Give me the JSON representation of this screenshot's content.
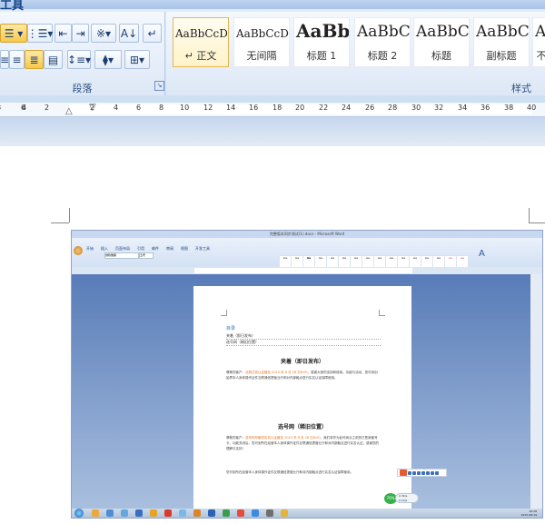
{
  "ribbon": {
    "tab_label": "工具",
    "paragraph_group_label": "段落",
    "styles_group_label": "样式",
    "styles": [
      {
        "sample": "AaBbCcDd",
        "name": "↵ 正文"
      },
      {
        "sample": "AaBbCcDc",
        "name": "无间隔"
      },
      {
        "sample": "AaBb",
        "name": "标题 1"
      },
      {
        "sample": "AaBbC",
        "name": "标题 2"
      },
      {
        "sample": "AaBbC",
        "name": "标题"
      },
      {
        "sample": "AaBbC",
        "name": "副标题"
      },
      {
        "sample": "A",
        "name": "不"
      }
    ]
  },
  "ruler": {
    "labels": [
      "8",
      "6",
      "4",
      "2",
      "2",
      "4",
      "6",
      "8",
      "10",
      "12",
      "14",
      "16",
      "18",
      "20",
      "22",
      "24",
      "26",
      "28",
      "30",
      "32",
      "34",
      "36",
      "38",
      "40"
    ]
  },
  "inner": {
    "window_title": "完整版本同步测试(1).docx - Microsoft Word",
    "tabs": [
      "开始",
      "插入",
      "页面布局",
      "引用",
      "邮件",
      "审阅",
      "视图",
      "开发工具"
    ],
    "font_name": "微软雅黑",
    "font_size": "五号",
    "document": {
      "toc_title": "目录",
      "toc_items": [
        "夹着（即日发布）",
        "选号网（稀旧位置）"
      ],
      "heading1": "夹着（即日发布）",
      "para1_prefix": "尊敬的客户：",
      "para1_highlight": "北规法官认证截至 2015 年 8 月 28 日8:00",
      "para1_rest": "，感谢大家的支持和使用。功能与活动，您可到创始界本人身体操作证件互联通信提营业厅和对内部触点进行实名认证保障使用。",
      "heading2": "选号网（稀旧位置）",
      "para2_prefix": "尊敬的客户：",
      "para2_highlight": "选号网号截将实名认证截至 2015 年 8 月 28 日8:00",
      "para2_rest": "，我们将作为此时间点之前的已售新客号卡，功能关闭后，您可到所在经营本人身体操作证件互联通信提营业厅和对内部触点进行实名认证，感谢您的理解与支持！",
      "para3": "您可到所在经营本人身体操作证件互联通信提营业厅和对内部触点进行实名认证保障使用。"
    },
    "speed_badge": "76%",
    "speed_up": "0.3K/s",
    "speed_down": "0.1K/s",
    "clock_time": "16:28",
    "clock_date": "2015-08-19"
  }
}
